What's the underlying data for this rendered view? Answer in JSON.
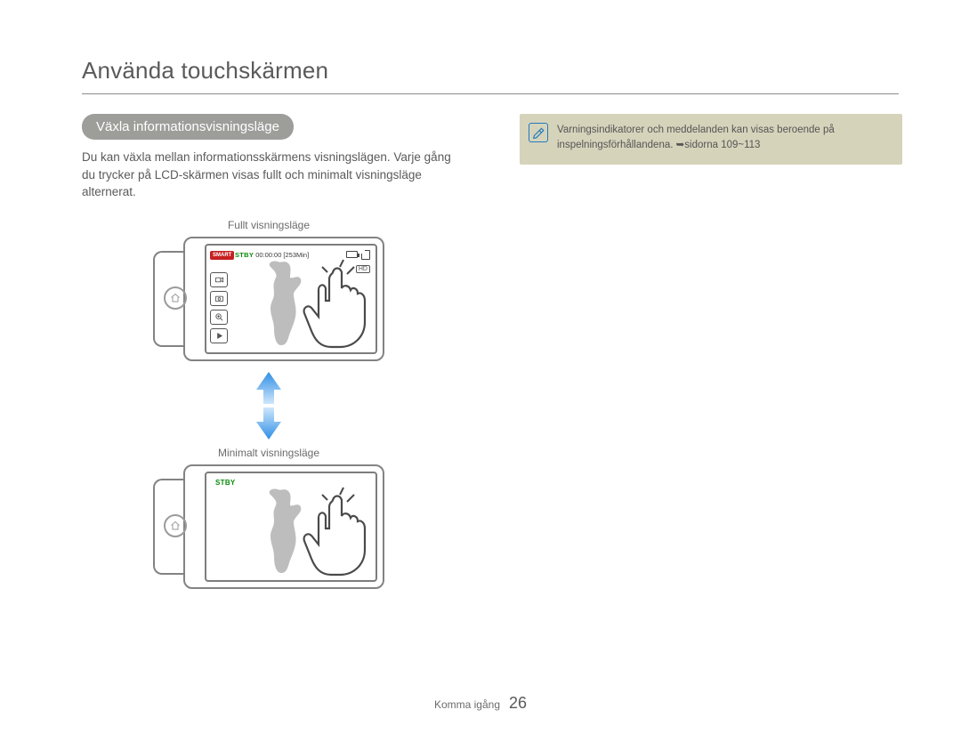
{
  "title": "Använda touchskärmen",
  "section_pill": "Växla informationsvisningsläge",
  "body_text": "Du kan växla mellan informationsskärmens visningslägen. Varje gång du trycker på LCD-skärmen visas fullt och minimalt visningsläge alternerat.",
  "caption_full": "Fullt visningsläge",
  "caption_minimal": "Minimalt visningsläge",
  "status": {
    "smart": "SMART",
    "stby": "STBY",
    "timecode": "00:00:00",
    "remaining": "[253Min]",
    "hd": "HD"
  },
  "note": {
    "text": "Varningsindikatorer och meddelanden kan visas beroende på inspelningsförhållandena. ",
    "ref": "sidorna 109~113"
  },
  "footer": {
    "section": "Komma igång",
    "page": "26"
  }
}
